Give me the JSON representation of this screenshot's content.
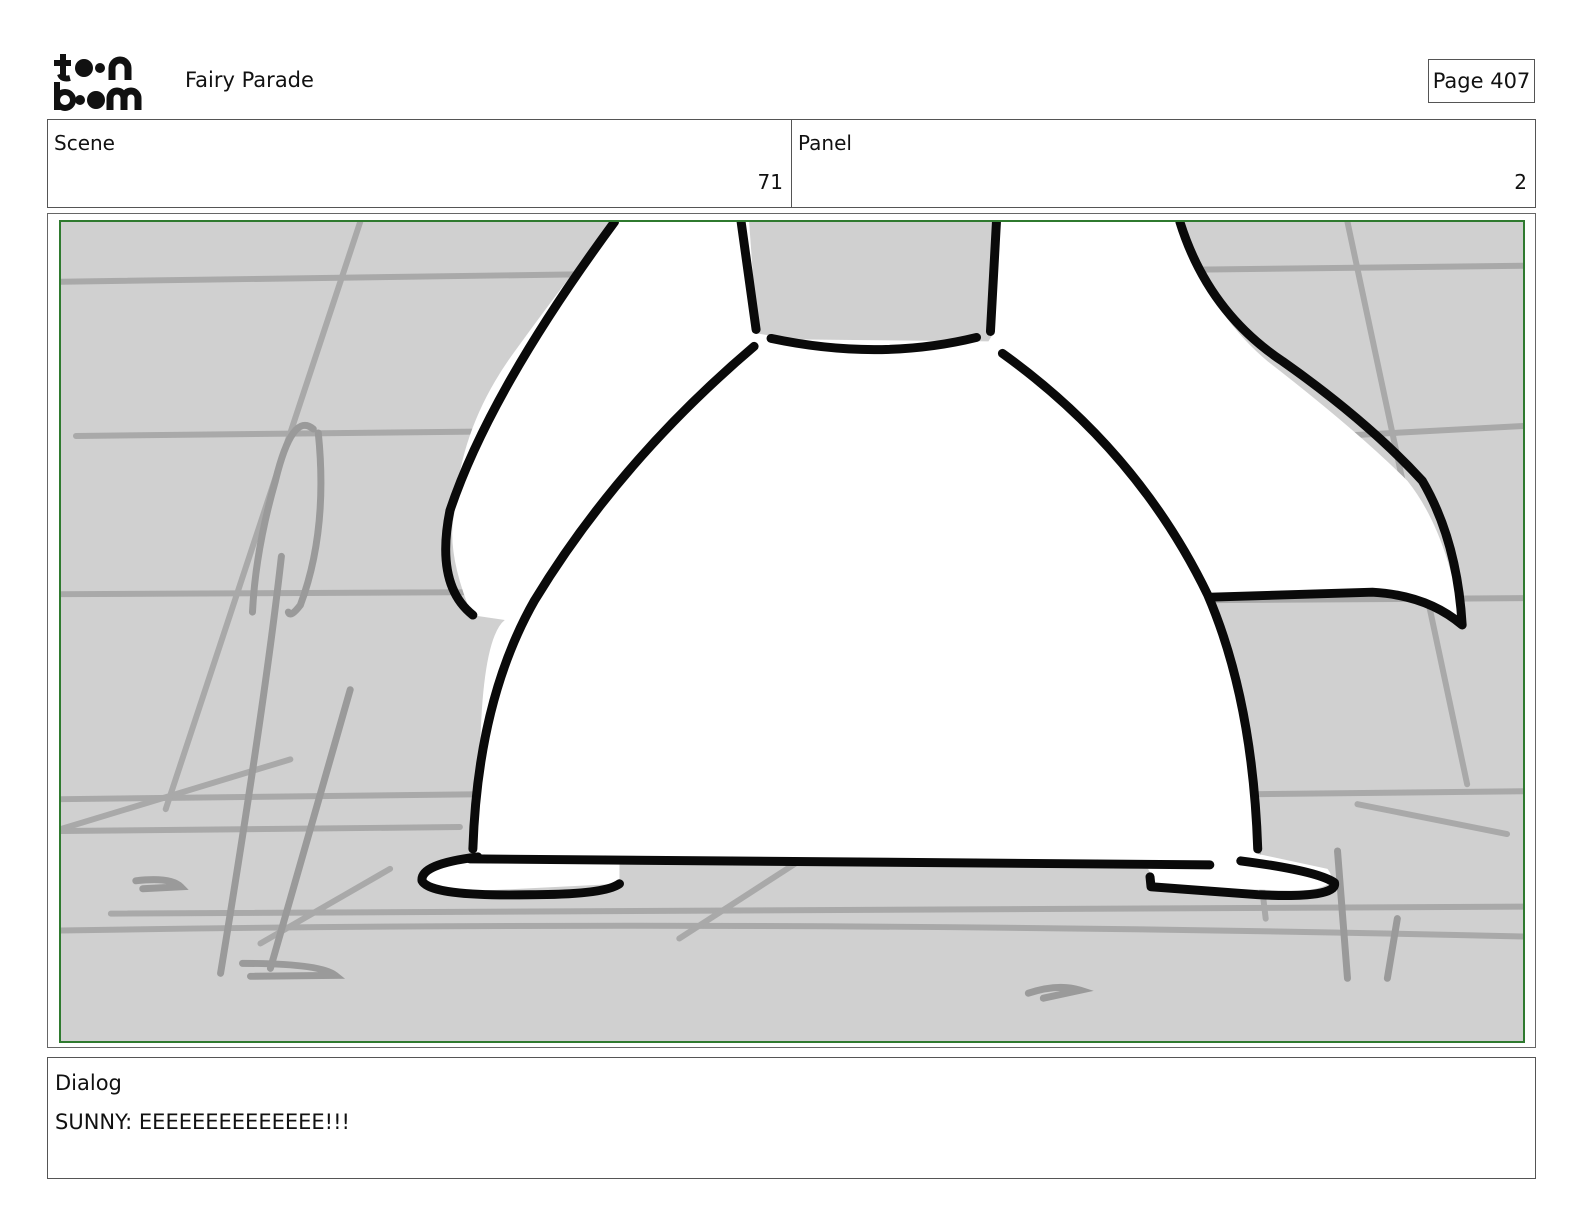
{
  "header": {
    "logo": {
      "text_top": "toon",
      "text_bottom": "boom"
    },
    "project_title": "Fairy Parade",
    "page_label": "Page 407"
  },
  "info": {
    "scene": {
      "label": "Scene",
      "value": "71"
    },
    "panel": {
      "label": "Panel",
      "value": "2"
    }
  },
  "frame": {
    "content": "storyboard-drawing",
    "background_color": "#d0d0d0",
    "safe_area_color": "#2f7a2f"
  },
  "dialog": {
    "label": "Dialog",
    "text": "SUNNY: EEEEEEEEEEEEEE!!!"
  }
}
